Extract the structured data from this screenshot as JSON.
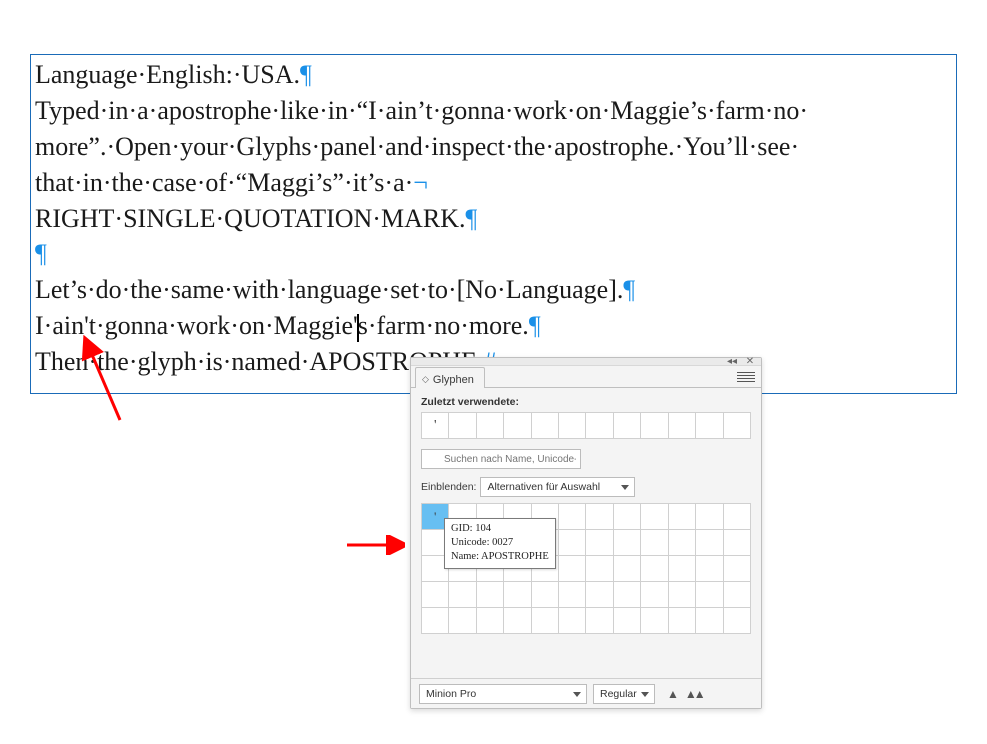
{
  "document": {
    "line1": "Language·English:·USA.",
    "line2": "Typed·in·a·apostrophe·like·in·“I·ain’t·gonna·work·on·Maggie’s·farm·no·",
    "line3": "more”.·Open·your·Glyphs·panel·and·inspect·the·apostrophe.·You’ll·see·",
    "line4": "that·in·the·case·of·“Maggi’s”·it’s·a·",
    "line5": "RIGHT·SINGLE·QUOTATION·MARK.",
    "pilcrow": "¶",
    "softreturn": "¬",
    "line7": "Let’s·do·the·same·with·language·set·to·[No·Language].",
    "line8a": "I·ain't·gonna·work·on·Maggie'",
    "line8b": "s·farm·no·more.",
    "line9": "Then·the·glyph·is·named·APOSTROPHE.",
    "frame_end": "#"
  },
  "panel": {
    "tab_label": "Glyphen",
    "recent_label": "Zuletzt verwendete:",
    "recent_glyphs": [
      "'"
    ],
    "search_placeholder": "Suchen nach Name, Unicode-Wert oder Zeichen-/Glyphen-I",
    "show_label": "Einblenden:",
    "show_value": "Alternativen für Auswahl",
    "selected_glyph": "'",
    "tooltip": {
      "gid_label": "GID:",
      "gid_value": "104",
      "unicode_label": "Unicode:",
      "unicode_value": "0027",
      "name_label": "Name:",
      "name_value": "APOSTROPHE"
    },
    "font_name": "Minion Pro",
    "font_style": "Regular"
  }
}
